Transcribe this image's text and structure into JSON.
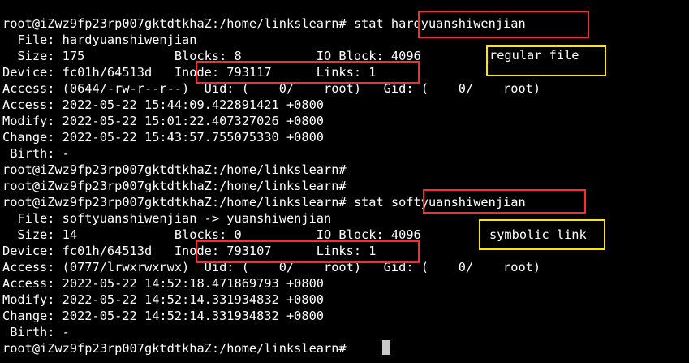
{
  "terminal": {
    "lines": [
      "root@iZwz9fp23rp007gktdtkhaZ:/home/linkslearn# stat hardyuanshiwenjian",
      "  File: hardyuanshiwenjian",
      "  Size: 175            Blocks: 8          IO Block: 4096",
      "Device: fc01h/64513d   Inode: 793117      Links: 1",
      "Access: (0644/-rw-r--r--)  Uid: (    0/    root)   Gid: (    0/    root)",
      "Access: 2022-05-22 15:44:09.422891421 +0800",
      "Modify: 2022-05-22 15:01:22.407327026 +0800",
      "Change: 2022-05-22 15:43:57.755075330 +0800",
      " Birth: -",
      "root@iZwz9fp23rp007gktdtkhaZ:/home/linkslearn#",
      "root@iZwz9fp23rp007gktdtkhaZ:/home/linkslearn#",
      "root@iZwz9fp23rp007gktdtkhaZ:/home/linkslearn# stat softyuanshiwenjian",
      "  File: softyuanshiwenjian -> yuanshiwenjian",
      "  Size: 14             Blocks: 0          IO Block: 4096",
      "Device: fc01h/64513d   Inode: 793107      Links: 1",
      "Access: (0777/lrwxrwxrwx)  Uid: (    0/    root)   Gid: (    0/    root)",
      "Access: 2022-05-22 14:52:18.471869793 +0800",
      "Modify: 2022-05-22 14:52:14.331934832 +0800",
      "Change: 2022-05-22 14:52:14.331934832 +0800",
      " Birth: -",
      "root@iZwz9fp23rp007gktdtkhaZ:/home/linkslearn#"
    ]
  },
  "annotations": {
    "hard_file_type": "regular file",
    "soft_file_type": "symbolic link"
  },
  "colors": {
    "background": "#000000",
    "text": "#ffffff",
    "highlight_box": "#ff2a2a",
    "note_box": "#ffe600",
    "cursor": "#c8c8c8"
  }
}
